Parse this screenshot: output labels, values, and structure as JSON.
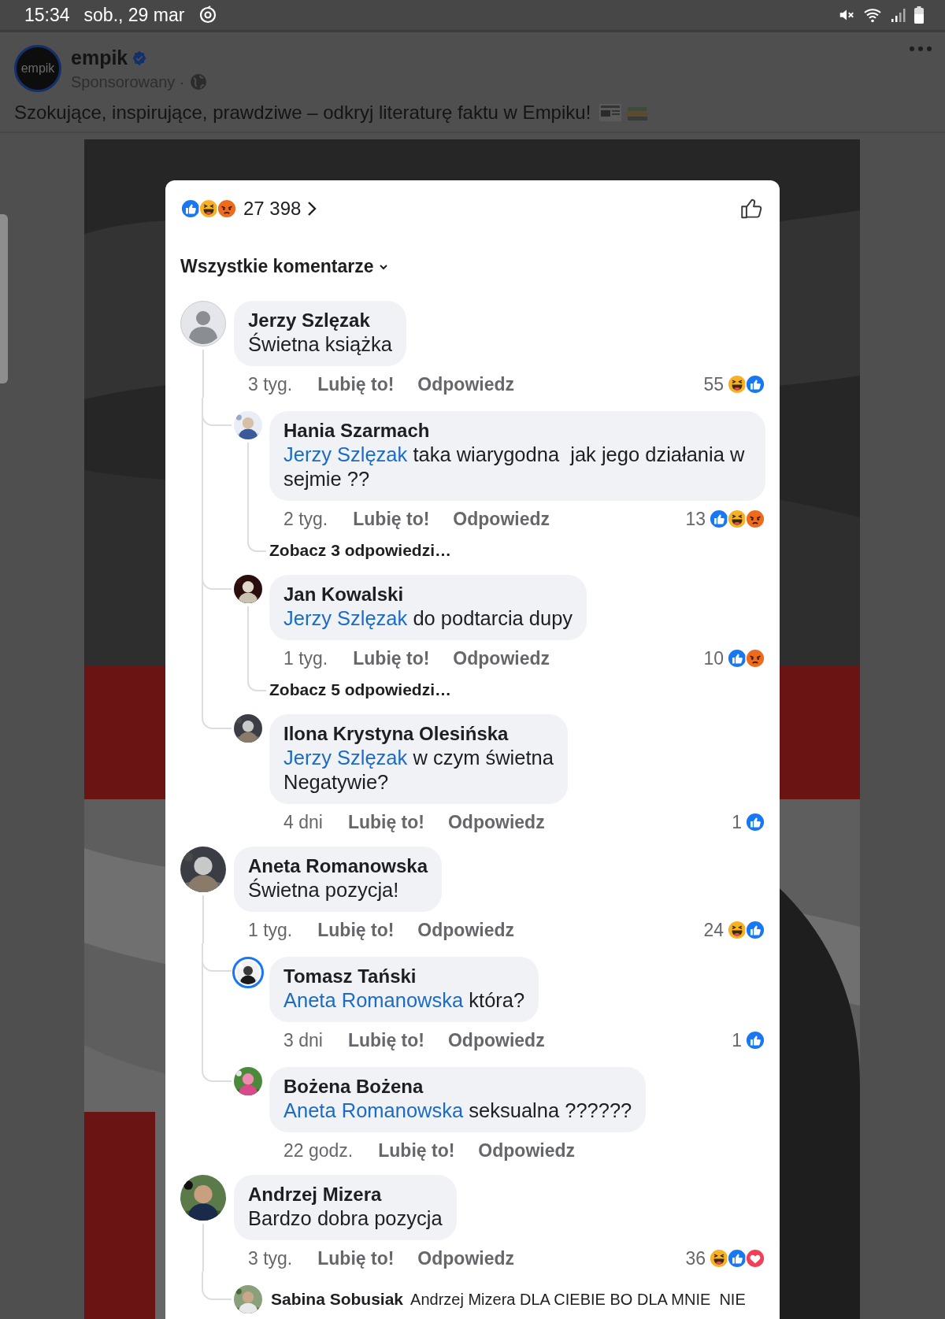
{
  "status_bar": {
    "time": "15:34",
    "date": "sob., 29 mar"
  },
  "post": {
    "logo_text": "empik",
    "author": "empik",
    "verified": true,
    "meta": "Sponsorowany ·",
    "caption": "Szokujące, inspirujące, prawdziwe – odkryj literaturę faktu w Empiku!"
  },
  "comments_sheet": {
    "reaction_total": "27 398",
    "reactions": [
      {
        "kind": "like"
      },
      {
        "kind": "haha"
      },
      {
        "kind": "angry"
      }
    ],
    "filter": "Wszystkie komentarze",
    "comments": [
      {
        "default_avatar": true,
        "name": "Jerzy Szlęzak",
        "text": "Świetna książka",
        "time": "3 tyg.",
        "like_label": "Lubię to!",
        "reply_label": "Odpowiedz",
        "reaction_count": "55",
        "reactions": [
          {
            "kind": "haha"
          },
          {
            "kind": "like"
          }
        ],
        "replies": [
          {
            "kind": "full",
            "name": "Hania Szarmach",
            "mention": "Jerzy Szlęzak",
            "text": "taka wiarygodna  jak jego działania w sejmie ??",
            "time": "2 tyg.",
            "like_label": "Lubię to!",
            "reply_label": "Odpowiedz",
            "reaction_count": "13",
            "reactions": [
              {
                "kind": "like"
              },
              {
                "kind": "haha"
              },
              {
                "kind": "angry"
              }
            ],
            "more_replies": "Zobacz 3 odpowiedzi…"
          },
          {
            "kind": "full",
            "name": "Jan Kowalski",
            "mention": "Jerzy Szlęzak",
            "text": "do podtarcia dupy",
            "time": "1 tyg.",
            "like_label": "Lubię to!",
            "reply_label": "Odpowiedz",
            "reaction_count": "10",
            "reactions": [
              {
                "kind": "like"
              },
              {
                "kind": "angry"
              }
            ],
            "more_replies": "Zobacz 5 odpowiedzi…"
          },
          {
            "kind": "full",
            "name": "Ilona Krystyna Olesińska",
            "mention": "Jerzy Szlęzak",
            "text": "w czym świetna\nNegatywie?",
            "time": "4 dni",
            "like_label": "Lubię to!",
            "reply_label": "Odpowiedz",
            "reaction_count": "1",
            "reactions": [
              {
                "kind": "like"
              }
            ]
          }
        ]
      },
      {
        "default_avatar": false,
        "name": "Aneta Romanowska",
        "text": "Świetna pozycja!",
        "time": "1 tyg.",
        "like_label": "Lubię to!",
        "reply_label": "Odpowiedz",
        "reaction_count": "24",
        "reactions": [
          {
            "kind": "haha"
          },
          {
            "kind": "like"
          }
        ],
        "replies": [
          {
            "kind": "full",
            "avatar_ring": true,
            "name": "Tomasz Tański",
            "mention": "Aneta Romanowska",
            "text": "która?",
            "time": "3 dni",
            "like_label": "Lubię to!",
            "reply_label": "Odpowiedz",
            "reaction_count": "1",
            "reactions": [
              {
                "kind": "like"
              }
            ]
          },
          {
            "kind": "full",
            "name": "Bożena Bożena",
            "mention": "Aneta Romanowska",
            "text": "seksualna ??????",
            "time": "22 godz.",
            "like_label": "Lubię to!",
            "reply_label": "Odpowiedz"
          }
        ]
      },
      {
        "default_avatar": false,
        "name": "Andrzej Mizera",
        "text": "Bardzo dobra pozycja",
        "time": "3 tyg.",
        "like_label": "Lubię to!",
        "reply_label": "Odpowiedz",
        "reaction_count": "36",
        "reactions": [
          {
            "kind": "haha"
          },
          {
            "kind": "like"
          },
          {
            "kind": "love"
          }
        ],
        "replies": [
          {
            "kind": "compact",
            "name": "Sabina Sobusiak",
            "text": "Andrzej Mizera DLA CIEBIE BO DLA MNIE  NIE"
          }
        ]
      }
    ]
  }
}
